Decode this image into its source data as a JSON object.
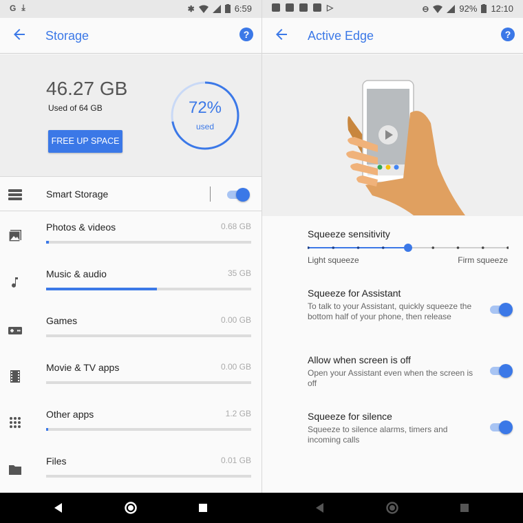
{
  "left": {
    "status": {
      "time": "6:59"
    },
    "appbar": {
      "title": "Storage"
    },
    "summary": {
      "used_value": "46.27 GB",
      "used_of": "Used of 64 GB",
      "free_button": "FREE UP SPACE",
      "percent_text": "72%",
      "percent_label": "used",
      "percent_fraction": 0.72
    },
    "smart_storage": {
      "label": "Smart Storage",
      "enabled": true
    },
    "categories": [
      {
        "label": "Photos & videos",
        "size": "0.68 GB",
        "fill": 0.012,
        "icon": "photo-icon"
      },
      {
        "label": "Music & audio",
        "size": "35 GB",
        "fill": 0.54,
        "icon": "music-note-icon"
      },
      {
        "label": "Games",
        "size": "0.00 GB",
        "fill": 0,
        "icon": "gamepad-icon"
      },
      {
        "label": "Movie & TV apps",
        "size": "0.00 GB",
        "fill": 0,
        "icon": "film-icon"
      },
      {
        "label": "Other apps",
        "size": "1.2 GB",
        "fill": 0.01,
        "icon": "apps-grid-icon"
      },
      {
        "label": "Files",
        "size": "0.01 GB",
        "fill": 0,
        "icon": "folder-icon"
      }
    ]
  },
  "right": {
    "status": {
      "battery": "92%",
      "time": "12:10"
    },
    "appbar": {
      "title": "Active Edge"
    },
    "sensitivity": {
      "title": "Squeeze sensitivity",
      "low_label": "Light squeeze",
      "high_label": "Firm squeeze",
      "steps": 9,
      "selected_step": 5
    },
    "settings": [
      {
        "title": "Squeeze for Assistant",
        "desc": "To talk to your Assistant, quickly squeeze the bottom half of your phone, then release",
        "enabled": true
      },
      {
        "title": "Allow when screen is off",
        "desc": "Open your Assistant even when the screen is off",
        "enabled": true
      },
      {
        "title": "Squeeze for silence",
        "desc": "Squeeze to silence alarms, timers and incoming calls",
        "enabled": true
      }
    ]
  },
  "colors": {
    "accent": "#3b78e7",
    "accent_light": "#a8c4f3",
    "skin": "#e0a060",
    "sleeve": "#c8863e"
  }
}
